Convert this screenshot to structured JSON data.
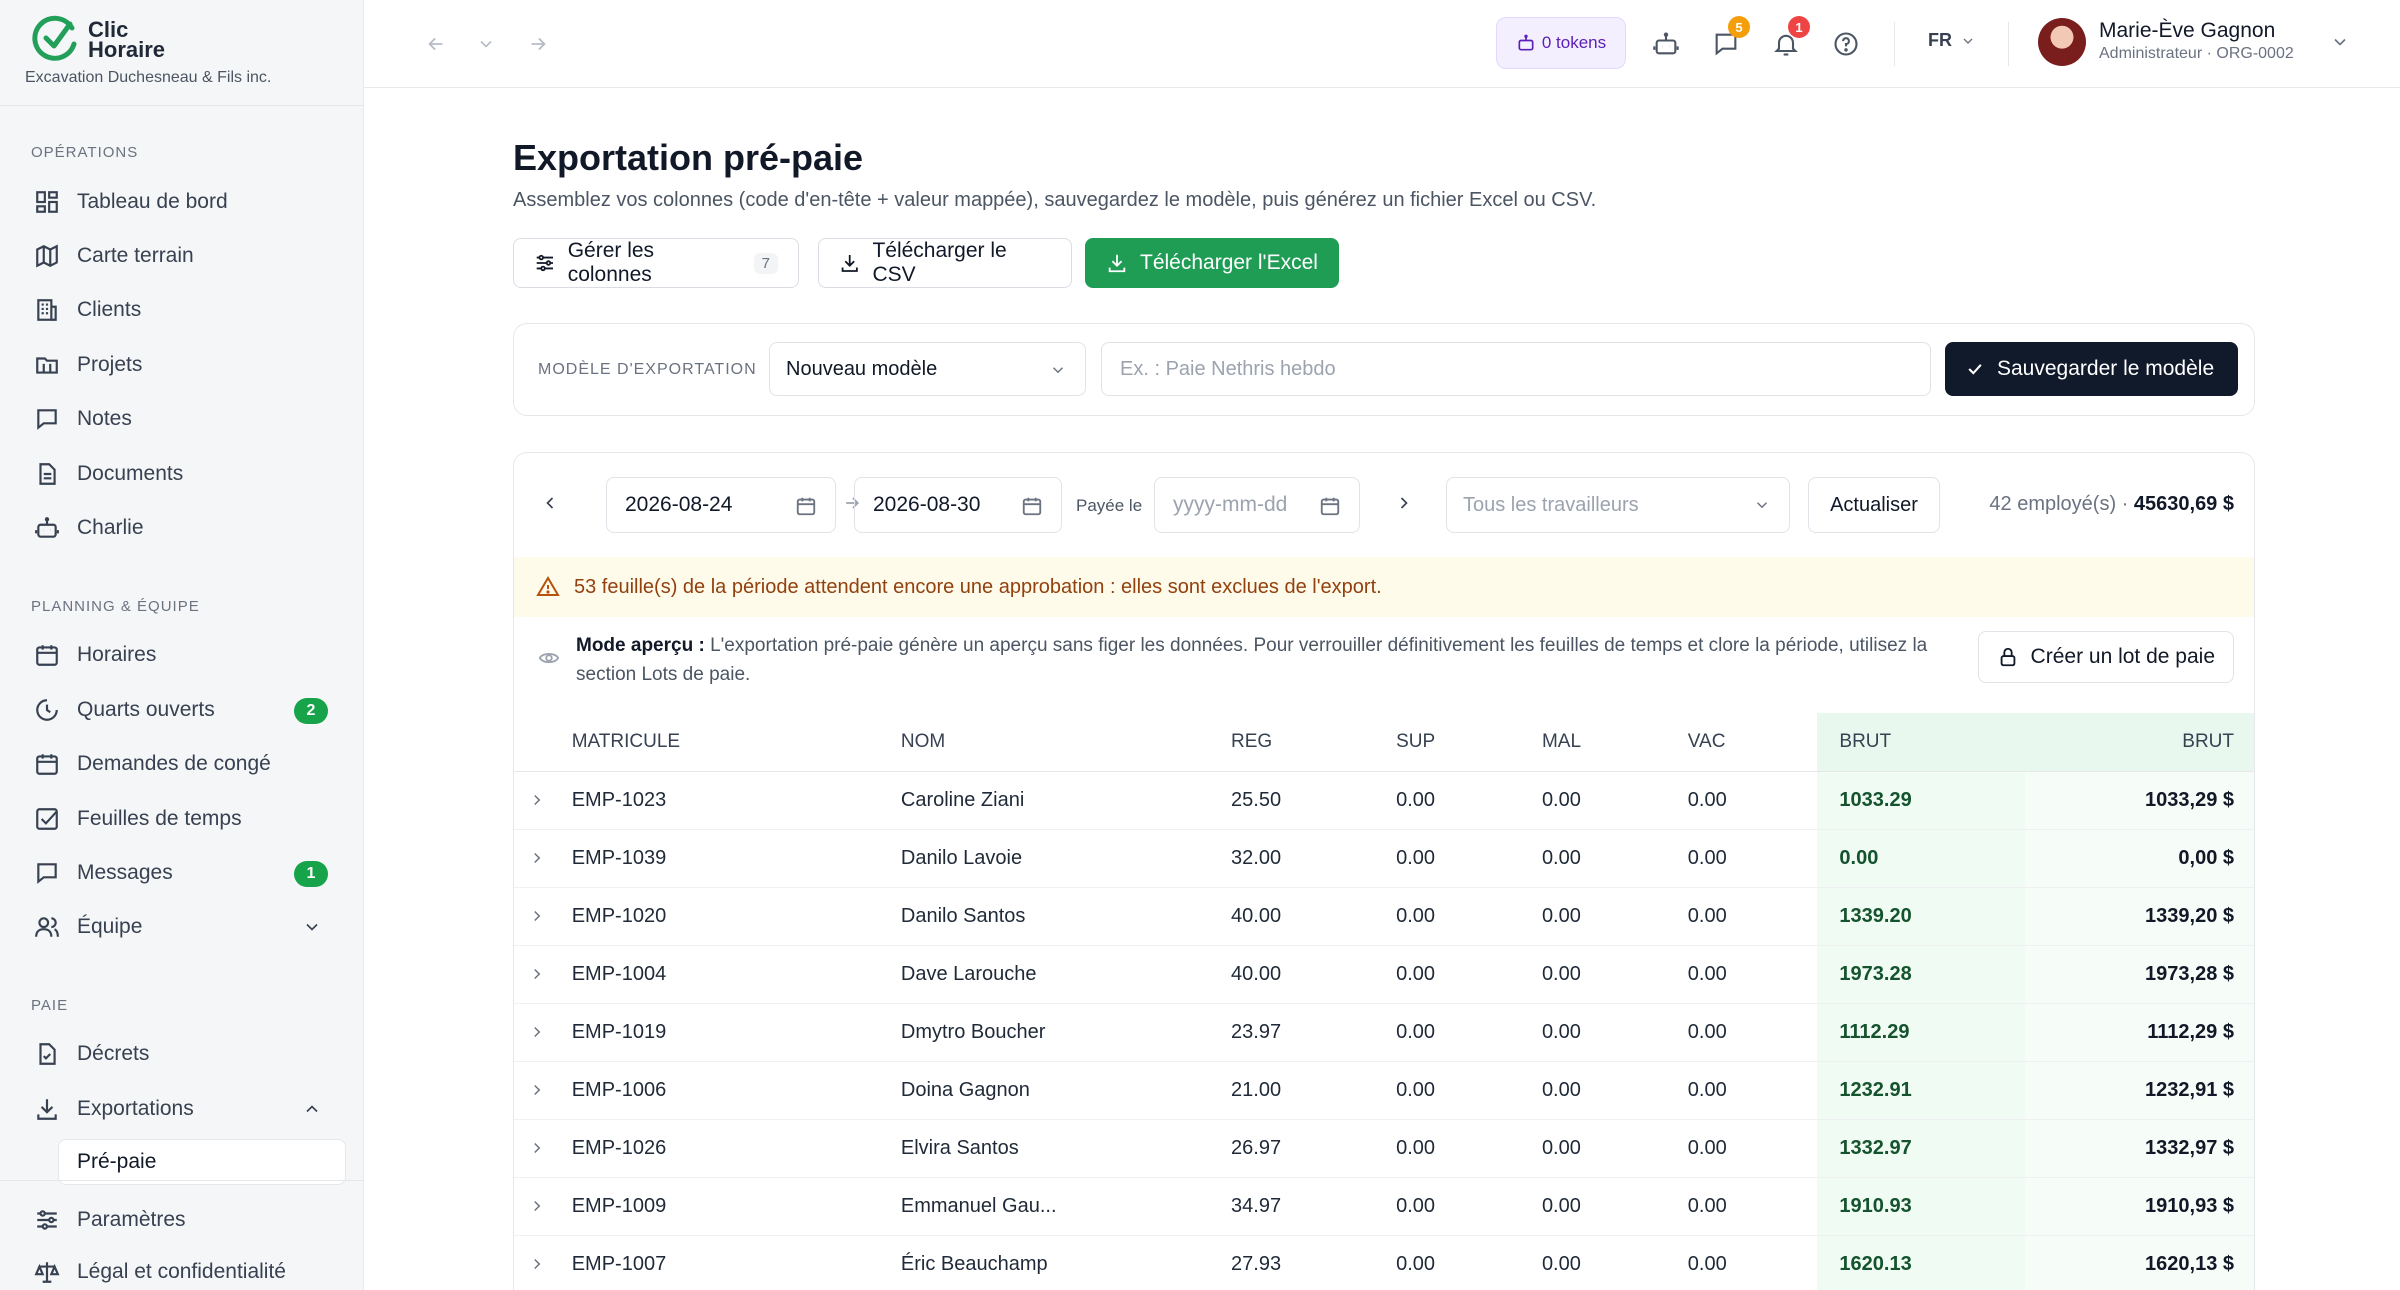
{
  "brand": {
    "name": "Clic Horaire",
    "org": "Excavation Duchesneau & Fils inc."
  },
  "sidebar": {
    "sections": [
      {
        "label": "OPÉRATIONS"
      },
      {
        "label": "PLANNING & ÉQUIPE"
      },
      {
        "label": "PAIE"
      }
    ],
    "items": [
      {
        "label": "Tableau de bord",
        "icon": "dashboard-icon"
      },
      {
        "label": "Carte terrain",
        "icon": "map-icon"
      },
      {
        "label": "Clients",
        "icon": "building-icon"
      },
      {
        "label": "Projets",
        "icon": "folder-icon"
      },
      {
        "label": "Notes",
        "icon": "note-icon"
      },
      {
        "label": "Documents",
        "icon": "document-icon"
      },
      {
        "label": "Charlie",
        "icon": "robot-icon"
      },
      {
        "label": "Horaires",
        "icon": "calendar-icon"
      },
      {
        "label": "Quarts ouverts",
        "icon": "clock-icon",
        "badge": "2"
      },
      {
        "label": "Demandes de congé",
        "icon": "calendar-icon"
      },
      {
        "label": "Feuilles de temps",
        "icon": "checklist-icon"
      },
      {
        "label": "Messages",
        "icon": "message-icon",
        "badge": "1"
      },
      {
        "label": "Équipe",
        "icon": "team-icon"
      },
      {
        "label": "Décrets",
        "icon": "file-check-icon"
      },
      {
        "label": "Exportations",
        "icon": "download-icon"
      },
      {
        "label": "Pré-paie"
      },
      {
        "label": "Paramètres",
        "icon": "sliders-icon"
      },
      {
        "label": "Légal et confidentialité",
        "icon": "scale-icon"
      }
    ]
  },
  "topbar": {
    "tokens": "0 tokens",
    "messages_badge": "5",
    "notifications_badge": "1",
    "lang": "FR",
    "user_name": "Marie-Ève Gagnon",
    "user_role": "Administrateur · ORG-0002"
  },
  "page": {
    "title": "Exportation pré-paie",
    "subtitle": "Assemblez vos colonnes (code d'en-tête + valeur mappée), sauvegardez le modèle, puis générez un fichier Excel ou CSV.",
    "btn_columns": "Gérer les colonnes",
    "btn_columns_count": "7",
    "btn_csv": "Télécharger le CSV",
    "btn_excel": "Télécharger l'Excel"
  },
  "template": {
    "label": "MODÈLE D'EXPORTATION",
    "selected": "Nouveau modèle",
    "name_placeholder": "Ex. : Paie Nethris hebdo",
    "save": "Sauvegarder le modèle"
  },
  "filters": {
    "start": "2026-08-24",
    "end": "2026-08-30",
    "paid_label": "Payée le",
    "paid_placeholder": "yyyy-mm-dd",
    "workers": "Tous les travailleurs",
    "refresh": "Actualiser",
    "summary_count": "42 employé(s)",
    "summary_sep": " · ",
    "summary_total": "45630,69 $"
  },
  "warning": "53 feuille(s) de la période attendent encore une approbation : elles sont exclues de l'export.",
  "preview": {
    "lead": "Mode aperçu :",
    "text": " L'exportation pré-paie génère un aperçu sans figer les données. Pour verrouiller définitivement les feuilles de temps et clore la période, utilisez la section Lots de paie.",
    "btn": "Créer un lot de paie"
  },
  "table": {
    "headers": [
      "MATRICULE",
      "NOM",
      "REG",
      "SUP",
      "MAL",
      "VAC",
      "BRUT",
      "BRUT"
    ],
    "rows": [
      [
        "EMP-1023",
        "Caroline Ziani",
        "25.50",
        "0.00",
        "0.00",
        "0.00",
        "1033.29",
        "1033,29 $"
      ],
      [
        "EMP-1039",
        "Danilo Lavoie",
        "32.00",
        "0.00",
        "0.00",
        "0.00",
        "0.00",
        "0,00 $"
      ],
      [
        "EMP-1020",
        "Danilo Santos",
        "40.00",
        "0.00",
        "0.00",
        "0.00",
        "1339.20",
        "1339,20 $"
      ],
      [
        "EMP-1004",
        "Dave Larouche",
        "40.00",
        "0.00",
        "0.00",
        "0.00",
        "1973.28",
        "1973,28 $"
      ],
      [
        "EMP-1019",
        "Dmytro Boucher",
        "23.97",
        "0.00",
        "0.00",
        "0.00",
        "1112.29",
        "1112,29 $"
      ],
      [
        "EMP-1006",
        "Doina Gagnon",
        "21.00",
        "0.00",
        "0.00",
        "0.00",
        "1232.91",
        "1232,91 $"
      ],
      [
        "EMP-1026",
        "Elvira Santos",
        "26.97",
        "0.00",
        "0.00",
        "0.00",
        "1332.97",
        "1332,97 $"
      ],
      [
        "EMP-1009",
        "Emmanuel Gau...",
        "34.97",
        "0.00",
        "0.00",
        "0.00",
        "1910.93",
        "1910,93 $"
      ],
      [
        "EMP-1007",
        "Éric Beauchamp",
        "27.93",
        "0.00",
        "0.00",
        "0.00",
        "1620.13",
        "1620,13 $"
      ]
    ]
  },
  "colors": {
    "accent_green": "#1f9d55",
    "dark": "#111a2b",
    "warning_bg": "#fffbeb"
  }
}
